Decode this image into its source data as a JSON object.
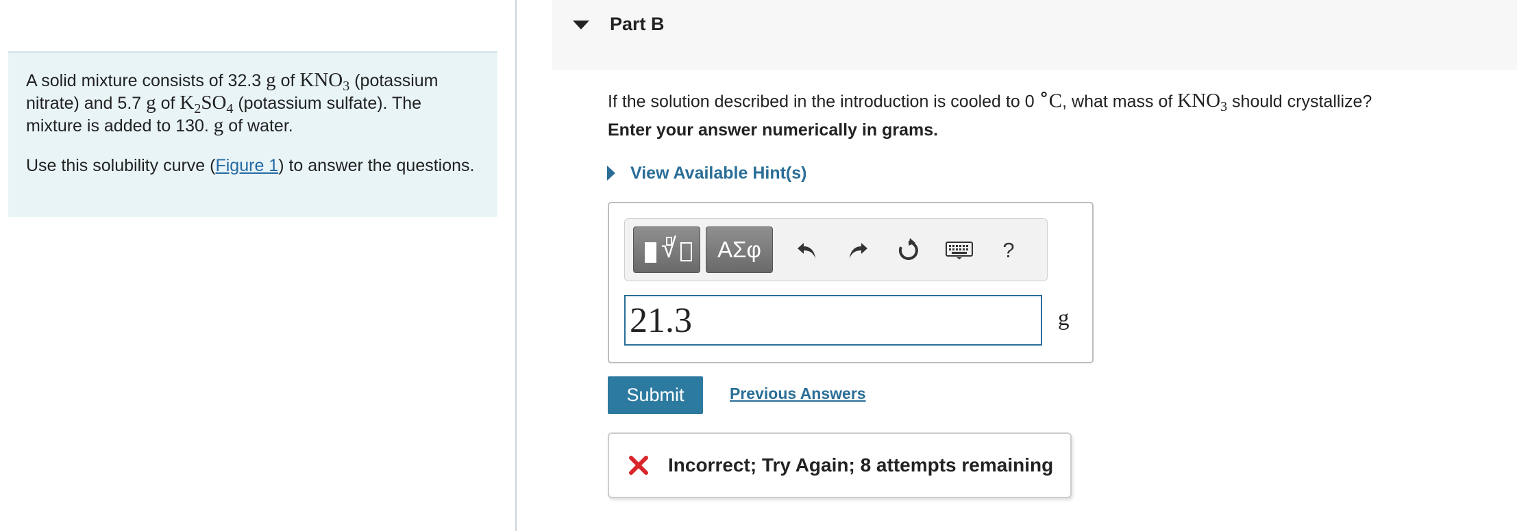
{
  "intro": {
    "p1_a": "A solid mixture consists of 32.3 ",
    "unit_g": "g",
    "of1": " of ",
    "kno3_main": "KNO",
    "kno3_sub": "3",
    "p1_b": " (potassium nitrate) and 5.7 ",
    "of2": " of ",
    "k2so4_k": "K",
    "k2so4_sub1": "2",
    "k2so4_so": "SO",
    "k2so4_sub2": "4",
    "p1_c": " (potassium sulfate).  The mixture is added to 130. ",
    "of3": " of water.",
    "p2_a": "Use this solubility curve (",
    "figure_link": "Figure 1",
    "p2_b": ") to answer the questions."
  },
  "part": {
    "title": "Part B"
  },
  "question": {
    "text_a": "If the solution described in the introduction is cooled to 0 ",
    "degree": "∘",
    "celsius": "C",
    "text_b": ", what mass of ",
    "kno3_main": "KNO",
    "kno3_sub": "3",
    "text_c": " should crystallize?",
    "instruction": "Enter your answer numerically in grams."
  },
  "hint": {
    "label": "View Available Hint(s)"
  },
  "toolbar": {
    "symbols_label": "ΑΣφ",
    "help_label": "?"
  },
  "answer": {
    "value": "21.3",
    "unit": "g"
  },
  "actions": {
    "submit_label": "Submit",
    "previous_answers_label": "Previous Answers"
  },
  "feedback": {
    "message": "Incorrect; Try Again; 8 attempts remaining",
    "icon": "x-mark-icon",
    "icon_color": "#d9262b"
  },
  "colors": {
    "intro_bg": "#e9f4f6",
    "accent": "#2a6e97",
    "submit_bg": "#2d7aa0"
  }
}
